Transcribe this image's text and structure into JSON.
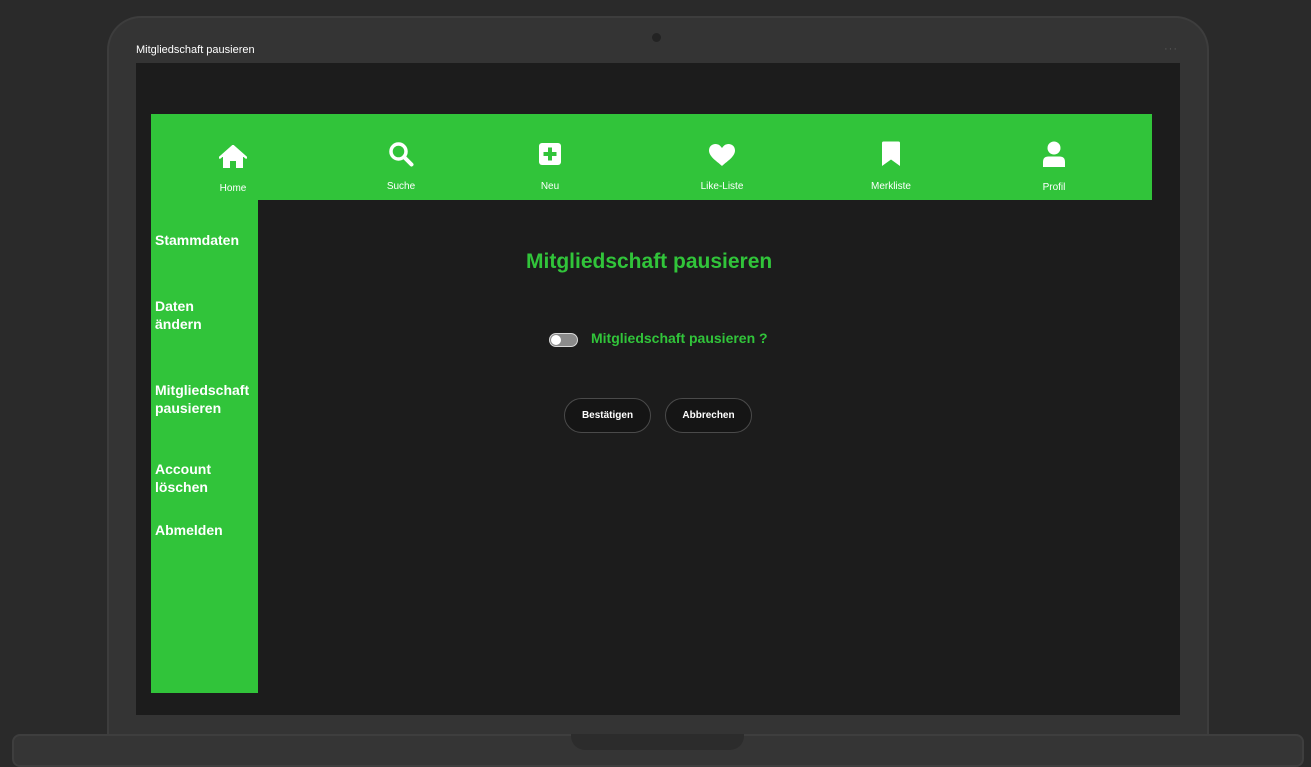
{
  "window": {
    "title": "Mitgliedschaft pausieren",
    "menu_dots": "···"
  },
  "topnav": {
    "items": [
      {
        "label": "Home",
        "icon": "home-icon"
      },
      {
        "label": "Suche",
        "icon": "search-icon"
      },
      {
        "label": "Neu",
        "icon": "plus-square-icon"
      },
      {
        "label": "Like-Liste",
        "icon": "heart-icon"
      },
      {
        "label": "Merkliste",
        "icon": "bookmark-icon"
      },
      {
        "label": "Profil",
        "icon": "user-icon"
      }
    ]
  },
  "sidebar": {
    "items": [
      {
        "label": "Stammdaten"
      },
      {
        "label": "Daten ändern"
      },
      {
        "label": "Mitgliedschaft pausieren"
      },
      {
        "label": "Account löschen"
      },
      {
        "label": "Abmelden"
      }
    ]
  },
  "main": {
    "title": "Mitgliedschaft pausieren",
    "toggle": {
      "label": "Mitgliedschaft pausieren ?",
      "checked": false
    },
    "confirm_label": "Bestätigen",
    "cancel_label": "Abbrechen"
  },
  "colors": {
    "accent": "#31c43a",
    "background": "#1c1c1c",
    "frame": "#343434"
  }
}
